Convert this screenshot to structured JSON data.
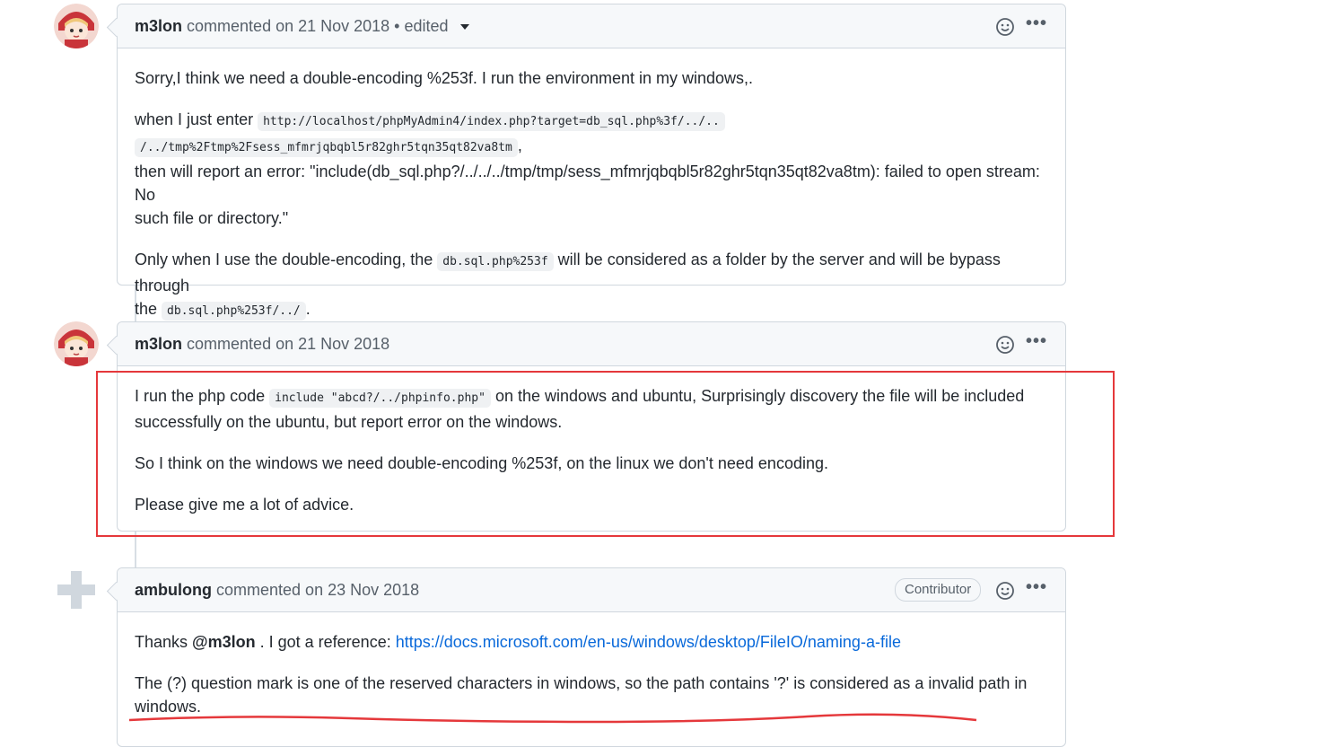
{
  "comments": [
    {
      "author": "m3lon",
      "meta": "commented on 21 Nov 2018 • edited",
      "p1": "Sorry,I think we need a double-encoding %253f. I run the environment in my windows,.",
      "p2_prefix": "when I just enter",
      "p2_code_a": "http://localhost/phpMyAdmin4/index.php?target=db_sql.php%3f/../..",
      "p2_code_b": "/../tmp%2Ftmp%2Fsess_mfmrjqbqbl5r82ghr5tqn35qt82va8tm",
      "p2_suffix": ",",
      "p2_line3": "then will report an error: \"include(db_sql.php?/../../../tmp/tmp/sess_mfmrjqbqbl5r82ghr5tqn35qt82va8tm): failed to open stream: No",
      "p2_line4": "such file or directory.\"",
      "p3_prefix": "Only when I use the double-encoding, the",
      "p3_code_a": "db.sql.php%253f",
      "p3_mid": "will be considered as a folder by the server and will be bypass through",
      "p3_the": "the",
      "p3_code_b": "db.sql.php%253f/../",
      "p3_end": "."
    },
    {
      "author": "m3lon",
      "meta": "commented on 21 Nov 2018",
      "p1_prefix": "I run the php code",
      "p1_code": "include \"abcd?/../phpinfo.php\"",
      "p1_suffix": "on the windows and ubuntu, Surprisingly discovery the file will be included",
      "p1_line2": "successfully on the ubuntu, but report error on the windows.",
      "p2": "So I think on the windows we need double-encoding %253f, on the linux we don't need encoding.",
      "p3": "Please give me a lot of advice."
    },
    {
      "author": "ambulong",
      "meta": "commented on 23 Nov 2018",
      "badge": "Contributor",
      "p1_prefix": "Thanks",
      "p1_mention": "@m3lon",
      "p1_mid": ". I got a reference:",
      "p1_link": "https://docs.microsoft.com/en-us/windows/desktop/FileIO/naming-a-file",
      "p2_line1": "The (?) question mark is one of the reserved characters in windows, so the path contains '?' is considered as a invalid path in",
      "p2_line2": "windows."
    }
  ],
  "icons": {
    "emoji": "smiley-icon",
    "more": "kebab-horizontal-icon",
    "caret": "caret-down-icon"
  },
  "colors": {
    "annotation": "#e5383b",
    "link": "#0969da"
  }
}
